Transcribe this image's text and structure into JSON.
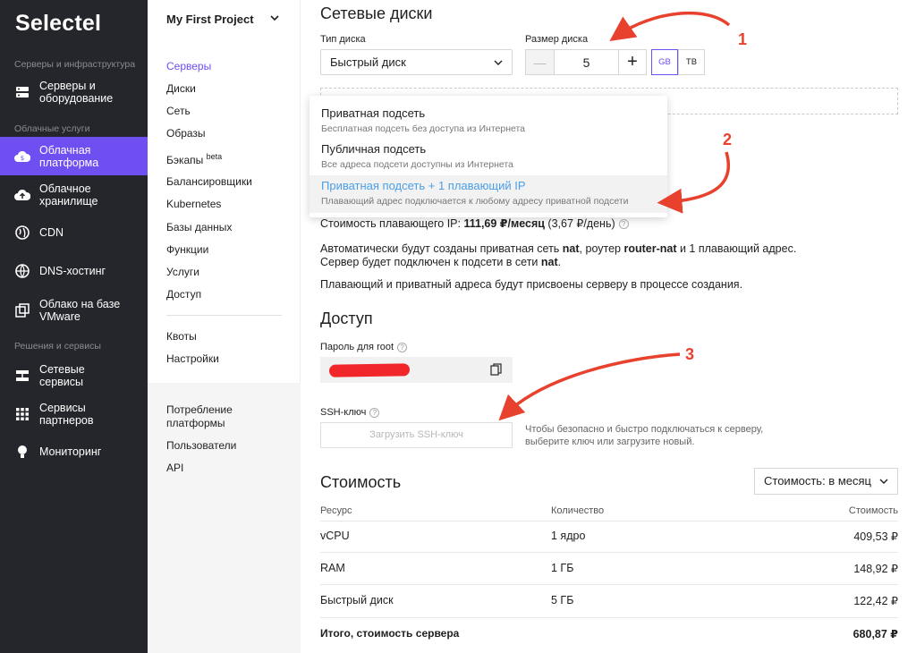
{
  "sidebar": {
    "logo": "Selectel",
    "sections": [
      "Серверы и инфраструктура",
      "Облачные услуги",
      "Решения и сервисы"
    ],
    "items": [
      {
        "label": "Серверы и оборудование",
        "icon": "server-icon"
      },
      {
        "label": "Облачная платформа",
        "icon": "cloud-platform-icon",
        "active": true
      },
      {
        "label": "Облачное хранилище",
        "icon": "cloud-upload-icon"
      },
      {
        "label": "CDN",
        "icon": "globe-icon"
      },
      {
        "label": "DNS-хостинг",
        "icon": "globe-icon"
      },
      {
        "label": "Облако на базе VMware",
        "icon": "vmware-icon"
      },
      {
        "label": "Сетевые сервисы",
        "icon": "network-icon"
      },
      {
        "label": "Сервисы партнеров",
        "icon": "grid-icon"
      },
      {
        "label": "Мониторинг",
        "icon": "bulb-icon"
      }
    ]
  },
  "subnav": {
    "project": "My First Project",
    "items": [
      "Серверы",
      "Диски",
      "Сеть",
      "Образы",
      "Бэкапы",
      "Балансировщики",
      "Kubernetes",
      "Базы данных",
      "Функции",
      "Услуги",
      "Доступ"
    ],
    "backups_badge": "beta",
    "items2": [
      "Квоты",
      "Настройки"
    ],
    "items3": [
      "Потребление платформы",
      "Пользователи",
      "API"
    ]
  },
  "disks": {
    "title": "Сетевые диски",
    "type_label": "Тип диска",
    "type_value": "Быстрый диск",
    "size_label": "Размер диска",
    "size_value": "5",
    "minus": "—",
    "plus": "+",
    "unit_gb": "GB",
    "unit_tb": "TB"
  },
  "dropdown": {
    "options": [
      {
        "title": "Приватная подсеть",
        "sub": "Бесплатная подсеть без доступа из Интернета"
      },
      {
        "title": "Публичная подсеть",
        "sub": "Все адреса подсети доступны из Интернета"
      },
      {
        "title": "Приватная подсеть + 1 плавающий IP",
        "sub": "Плавающий адрес подключается к любому адресу приватной подсети",
        "highlighted": true
      }
    ]
  },
  "network_info": {
    "price_prefix": "Стоимость плавающего IP: ",
    "price_bold": "111,69 ₽/месяц",
    "price_suffix": " (3,67 ₽/день)",
    "auto_1": "Автоматически будут созданы приватная сеть ",
    "auto_nat": "nat",
    "auto_2": ", роутер ",
    "auto_router": "router-nat",
    "auto_3": " и 1 плавающий адрес.",
    "auto_4": "Сервер будет подключен к подсети в сети ",
    "auto_5": ".",
    "assign": "Плавающий и приватный адреса будут присвоены серверу в процессе создания."
  },
  "access": {
    "title": "Доступ",
    "password_label": "Пароль для root",
    "ssh_label": "SSH-ключ",
    "ssh_button": "Загрузить SSH-ключ",
    "ssh_note_1": "Чтобы безопасно и быстро подключаться к серверу,",
    "ssh_note_2": "выберите ключ или загрузите новый."
  },
  "cost": {
    "title": "Стоимость",
    "period": "Стоимость: в месяц",
    "headers": [
      "Ресурс",
      "Количество",
      "Стоимость"
    ],
    "rows": [
      [
        "vCPU",
        "1 ядро",
        "409,53 ₽"
      ],
      [
        "RAM",
        "1 ГБ",
        "148,92 ₽"
      ],
      [
        "Быстрый диск",
        "5 ГБ",
        "122,42 ₽"
      ]
    ],
    "total": [
      "Итого, стоимость сервера",
      "680,87 ₽"
    ]
  },
  "annotations": [
    "1",
    "2",
    "3"
  ],
  "colors": {
    "accent": "#6f4ef2",
    "sidebar": "#25262b",
    "arrow": "#e8412d",
    "highlight_text": "#4a9ee6"
  }
}
